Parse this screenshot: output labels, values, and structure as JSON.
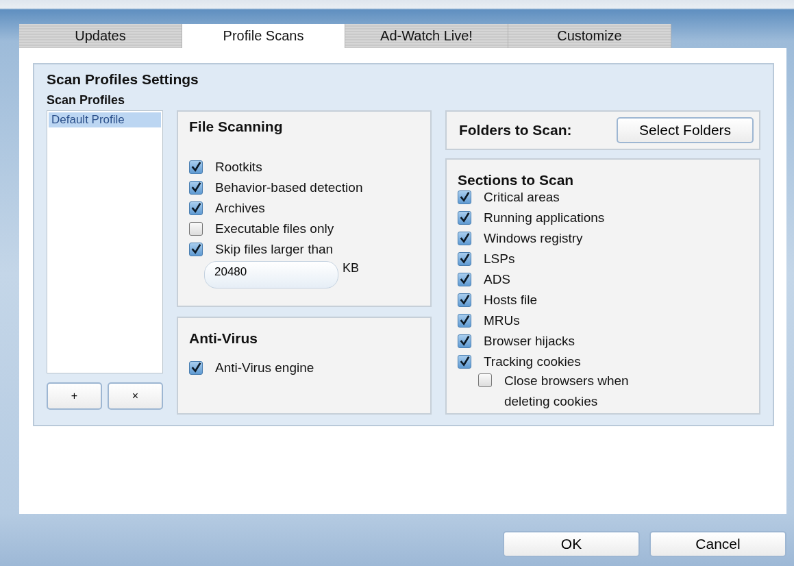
{
  "tabs": [
    {
      "label": "Updates",
      "selected": false
    },
    {
      "label": "Profile Scans",
      "selected": true
    },
    {
      "label": "Ad-Watch Live!",
      "selected": false
    },
    {
      "label": "Customize",
      "selected": false
    }
  ],
  "settings": {
    "title": "Scan Profiles Settings",
    "profiles": {
      "label": "Scan Profiles",
      "items": [
        {
          "label": "Default Profile",
          "selected": true
        }
      ],
      "buttons": [
        "+",
        "×"
      ]
    },
    "file_scanning": {
      "title": "File Scanning",
      "options": [
        {
          "label": "Rootkits",
          "checked": true
        },
        {
          "label": "Behavior-based detection",
          "checked": true
        },
        {
          "label": "Archives",
          "checked": true
        },
        {
          "label": "Executable files only",
          "checked": false
        },
        {
          "label": "Skip files larger than",
          "checked": true
        }
      ],
      "size_field": {
        "value": "20480",
        "unit": "KB"
      }
    },
    "anti_virus": {
      "title": "Anti-Virus",
      "options": [
        {
          "label": "Anti-Virus engine",
          "checked": true
        }
      ]
    },
    "folders": {
      "label": "Folders to Scan:",
      "button": "Select Folders"
    },
    "sections": {
      "title": "Sections to Scan",
      "options": [
        {
          "label": "Critical areas",
          "checked": true
        },
        {
          "label": "Running applications",
          "checked": true
        },
        {
          "label": "Windows registry",
          "checked": true
        },
        {
          "label": "LSPs",
          "checked": true
        },
        {
          "label": "ADS",
          "checked": true
        },
        {
          "label": "Hosts file",
          "checked": true
        },
        {
          "label": "MRUs",
          "checked": true
        },
        {
          "label": "Browser hijacks",
          "checked": true
        },
        {
          "label": "Tracking cookies",
          "checked": true,
          "children": [
            {
              "label": "Close browsers when deleting cookies",
              "checked": false
            }
          ]
        }
      ]
    }
  },
  "buttons": [
    "OK",
    "Cancel"
  ]
}
